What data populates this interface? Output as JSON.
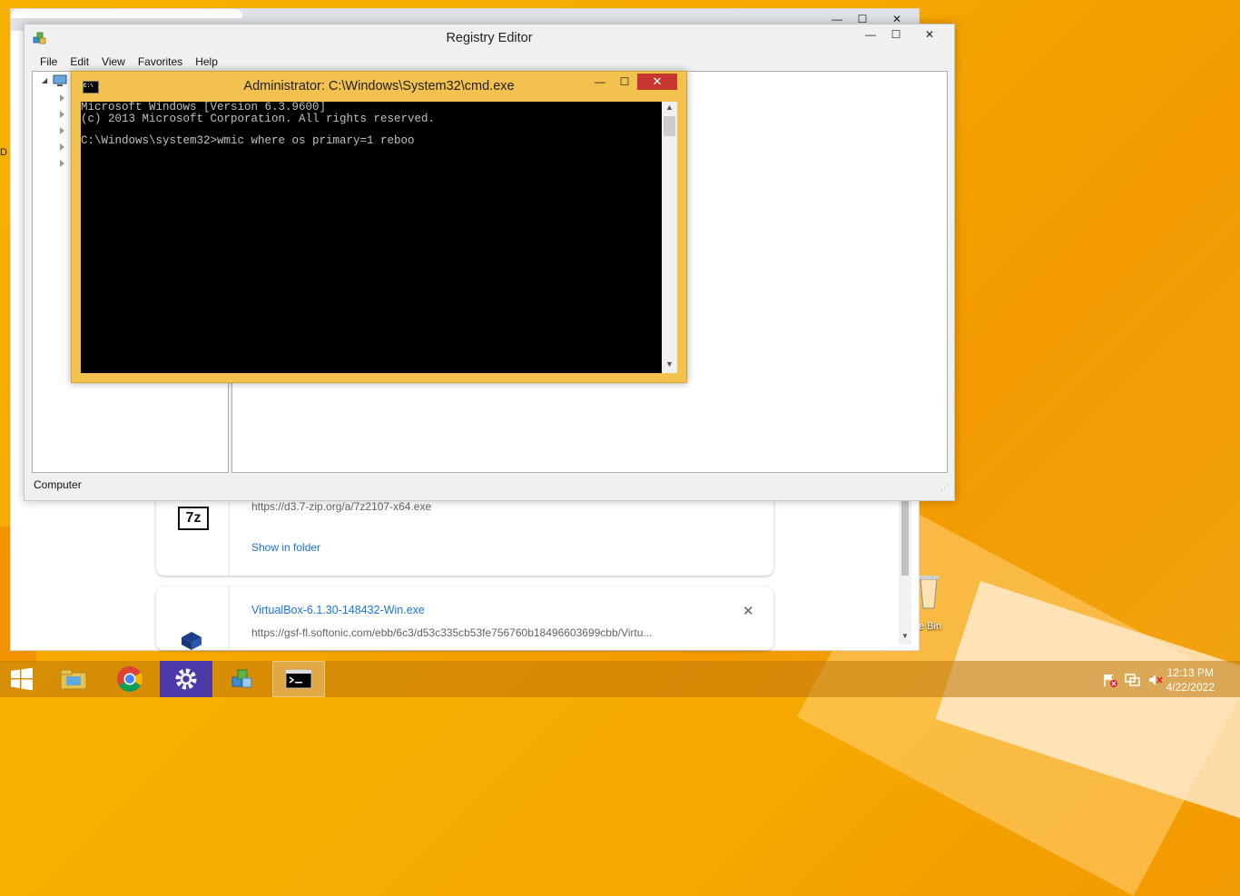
{
  "desktop": {
    "recycle_bin_label": "e Bin",
    "edge_letter": "D"
  },
  "chrome": {
    "downloads": [
      {
        "url": "https://d3.7-zip.org/a/7z2107-x64.exe",
        "action": "Show in folder",
        "icon_text": "7z"
      },
      {
        "name": "VirtualBox-6.1.30-148432-Win.exe",
        "url": "https://gsf-fl.softonic.com/ebb/6c3/d53c335cb53fe756760b18496603699cbb/Virtu...",
        "close_glyph": "✕"
      }
    ],
    "controls": {
      "minimize": "—",
      "maximize": "☐",
      "close": "✕"
    }
  },
  "registry": {
    "title": "Registry Editor",
    "menu": [
      "File",
      "Edit",
      "View",
      "Favorites",
      "Help"
    ],
    "status": "Computer",
    "controls": {
      "minimize": "—",
      "maximize": "☐",
      "close": "✕"
    }
  },
  "cmd": {
    "title": "Administrator: C:\\Windows\\System32\\cmd.exe",
    "lines": [
      "Microsoft Windows [Version 6.3.9600]",
      "(c) 2013 Microsoft Corporation. All rights reserved.",
      "",
      "C:\\Windows\\system32>wmic where os primary=1 reboo"
    ],
    "icon_text": "C:\\",
    "controls": {
      "minimize": "—",
      "maximize": "☐",
      "close": "✕"
    }
  },
  "taskbar": {
    "apps": [
      "file-explorer",
      "chrome",
      "settings",
      "registry-editor",
      "command-prompt"
    ],
    "time": "12:13 PM",
    "date": "4/22/2022"
  }
}
